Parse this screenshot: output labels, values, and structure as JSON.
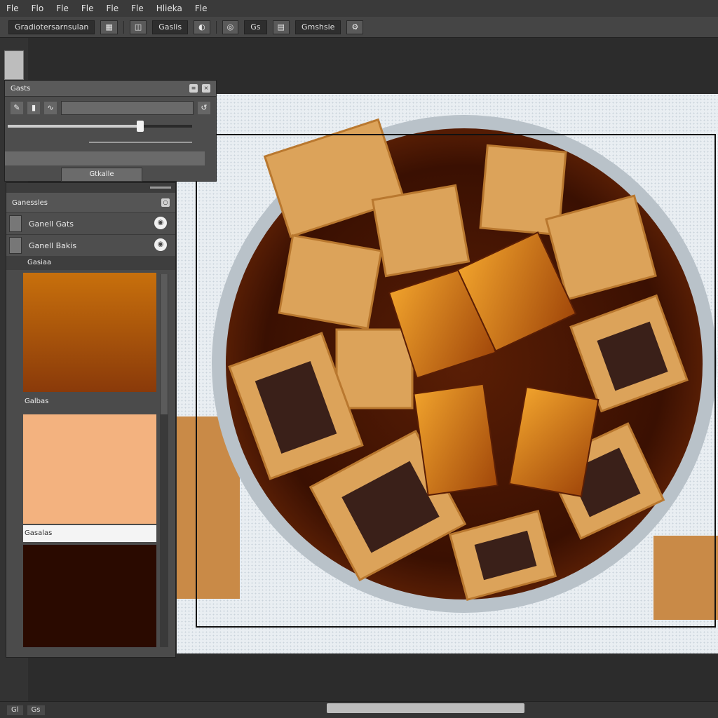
{
  "menu": [
    "Fle",
    "Flo",
    "Fle",
    "Fle",
    "Fle",
    "Fle",
    "Hlieka",
    "Fle"
  ],
  "options": {
    "preset_field": "Gradiotersarnsulan",
    "mode_field": "Gaslis",
    "size_field": "Gs",
    "zoom_field": "Gmshsie"
  },
  "panel_a": {
    "title": "Gasts",
    "slider_value": 0.72,
    "apply_label": "Gtkalle"
  },
  "panel_b": {
    "title": "Ganessles",
    "layers": [
      {
        "label": "Ganell Gats"
      },
      {
        "label": "Ganell Bakis"
      }
    ],
    "sub_label": "Gasiaa",
    "swatches": [
      {
        "label": "",
        "color_top": "#c8700c",
        "color_bottom": "#8a3a0a"
      },
      {
        "label": "Galbas",
        "color": "#f3b27f"
      },
      {
        "label": "Gasalas",
        "color": "#2a0a00"
      }
    ]
  },
  "status": {
    "zoom": "Gl",
    "doc": "Gs"
  },
  "colors": {
    "accent_caramel": "#c8700c",
    "accent_peach": "#f3b27f",
    "accent_dark": "#2a0a00"
  }
}
